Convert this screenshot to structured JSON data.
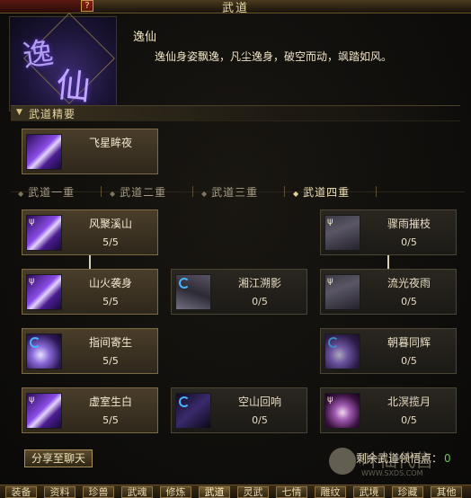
{
  "window": {
    "title": "武道",
    "help_label": "?"
  },
  "header": {
    "emblem_char1": "逸",
    "emblem_char2": "仙",
    "name": "逸仙",
    "description": "逸仙身姿飘逸，凡尘逸身，破空而动，飒踏如风。"
  },
  "essence": {
    "section_label": "武道精要",
    "skill": {
      "name": "飞星眸夜",
      "icon": "purple-slash-icon"
    }
  },
  "tabs": [
    {
      "label": "武道一重",
      "active": false
    },
    {
      "label": "武道二重",
      "active": false
    },
    {
      "label": "武道三重",
      "active": false
    },
    {
      "label": "武道四重",
      "active": true
    }
  ],
  "skills": [
    {
      "name": "风聚溪山",
      "level": "5/5",
      "icon": "purple-slash-icon",
      "active": true
    },
    {
      "name": "骤雨摧枝",
      "level": "0/5",
      "icon": "gray-lines-icon",
      "active": false
    },
    {
      "name": "山火袭身",
      "level": "5/5",
      "icon": "purple-slash-icon",
      "active": true
    },
    {
      "name": "湘江溯影",
      "level": "0/5",
      "icon": "gray-lines-icon",
      "active": false
    },
    {
      "name": "流光夜雨",
      "level": "0/5",
      "icon": "gray-lines-icon",
      "active": false
    },
    {
      "name": "指间寄生",
      "level": "5/5",
      "icon": "purple-orb-icon",
      "active": true
    },
    {
      "name": "朝暮同辉",
      "level": "0/5",
      "icon": "purple-orb-icon",
      "active": false
    },
    {
      "name": "虚室生白",
      "level": "5/5",
      "icon": "purple-slash-icon",
      "active": true
    },
    {
      "name": "空山回响",
      "level": "0/5",
      "icon": "dark-purple-icon",
      "active": false
    },
    {
      "name": "北溟揽月",
      "level": "0/5",
      "icon": "purple-swirl-icon",
      "active": false
    }
  ],
  "footer": {
    "share_label": "分享至聊天",
    "remain_label": "剩余武道领悟点：",
    "remain_value": "0"
  },
  "watermark": {
    "text": "叶仙代售",
    "sub": "WWW.SXDS.COM"
  },
  "bottom_tabs": [
    {
      "label": "装备",
      "active": false
    },
    {
      "label": "资料",
      "active": false
    },
    {
      "label": "珍兽",
      "active": false
    },
    {
      "label": "武魂",
      "active": false
    },
    {
      "label": "修炼",
      "active": false
    },
    {
      "label": "武道",
      "active": true
    },
    {
      "label": "灵武",
      "active": false
    },
    {
      "label": "七情",
      "active": false
    },
    {
      "label": "雕纹",
      "active": false
    },
    {
      "label": "武境",
      "active": false
    },
    {
      "label": "珍藏",
      "active": false
    },
    {
      "label": "其他",
      "active": false
    }
  ],
  "colors": {
    "gold_border": "#7c6a44",
    "accent_purple": "#8a4ce6",
    "remain_value": "#6ac84a"
  }
}
